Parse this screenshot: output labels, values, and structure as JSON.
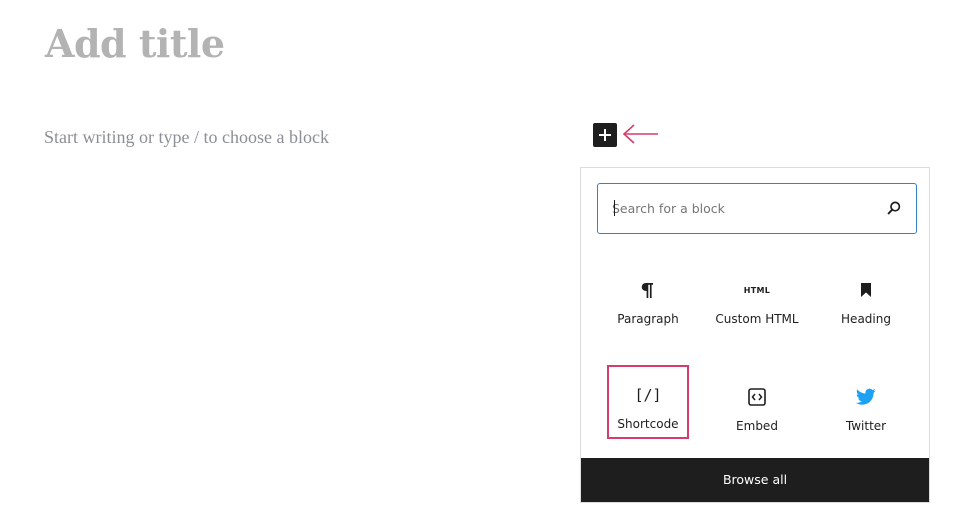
{
  "editor": {
    "title_placeholder": "Add title",
    "block_placeholder": "Start writing or type / to choose a block"
  },
  "inserter": {
    "toggle_icon": "plus-icon",
    "annotation_icon": "arrow-left-icon",
    "annotation_color": "#d63d6a",
    "search": {
      "placeholder": "Search for a block",
      "value": "",
      "icon": "search-icon",
      "border_color": "#3582c4"
    },
    "blocks": [
      {
        "label": "Paragraph",
        "icon": "paragraph-icon",
        "highlighted": false
      },
      {
        "label": "Custom HTML",
        "icon": "html-icon",
        "icon_text": "HTML",
        "highlighted": false
      },
      {
        "label": "Heading",
        "icon": "bookmark-icon",
        "highlighted": false
      },
      {
        "label": "Shortcode",
        "icon": "shortcode-icon",
        "icon_text": "[/]",
        "highlighted": true
      },
      {
        "label": "Embed",
        "icon": "embed-icon",
        "highlighted": false
      },
      {
        "label": "Twitter",
        "icon": "twitter-icon",
        "icon_color": "#1da1f2",
        "highlighted": false
      }
    ],
    "browse_all_label": "Browse all",
    "highlight_color": "#d63d6a",
    "footer_color": "#1e1e1e"
  }
}
